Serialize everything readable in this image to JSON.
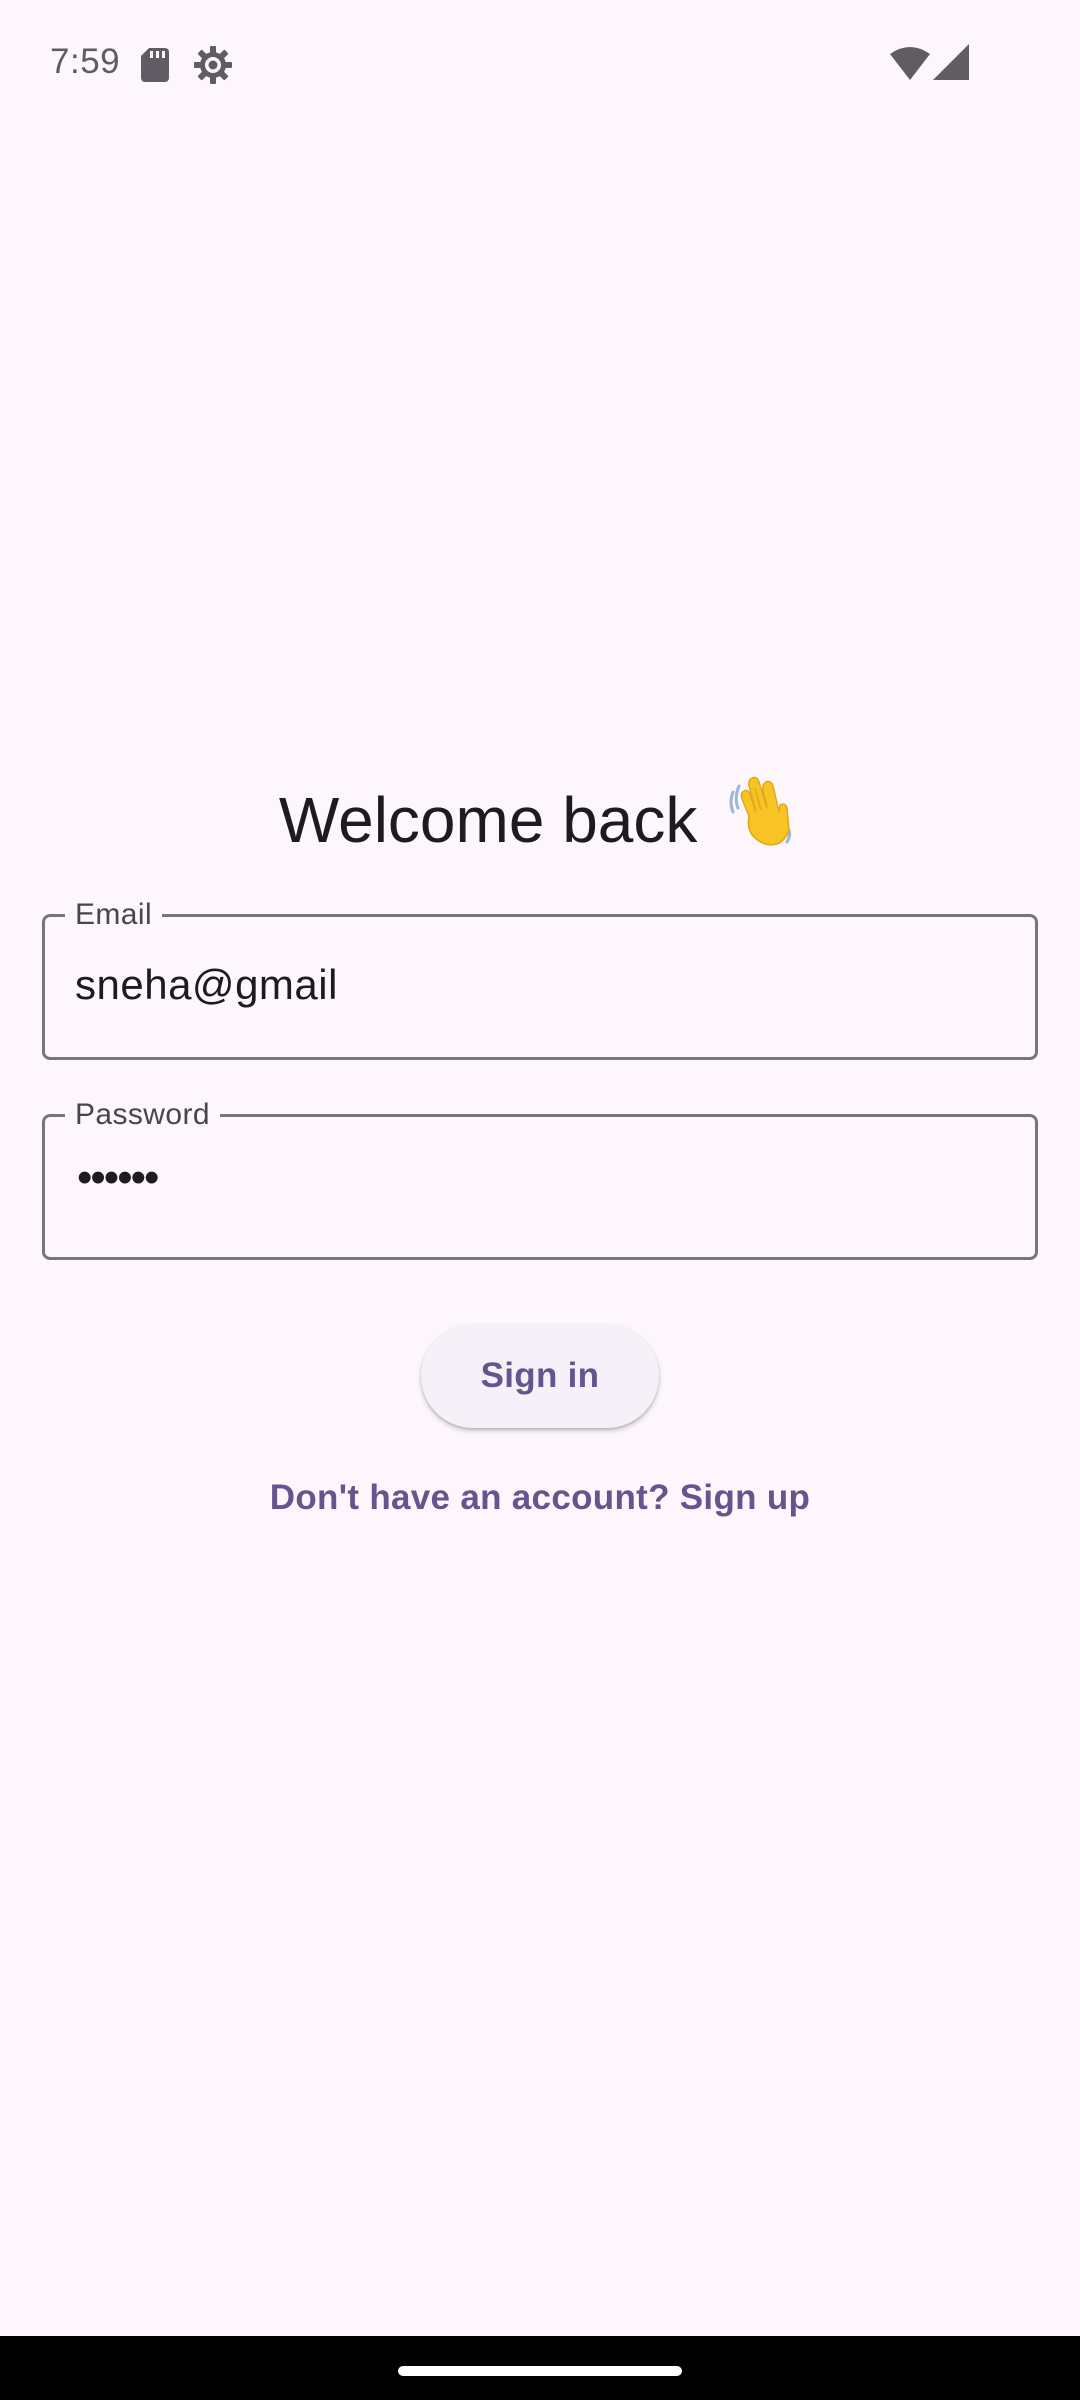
{
  "status_bar": {
    "time": "7:59",
    "icons": [
      "sd-card-icon",
      "gear-icon",
      "wifi-icon",
      "signal-icon"
    ]
  },
  "login": {
    "title": "Welcome back",
    "title_emoji_icon": "waving-hand-icon",
    "email": {
      "label": "Email",
      "value": "sneha@gmail"
    },
    "password": {
      "label": "Password",
      "masked_value": "••••••"
    },
    "signin_label": "Sign in",
    "signup_link": "Don't have an account? Sign up"
  },
  "colors": {
    "background": "#fdf6fc",
    "primary": "#65558f",
    "outline": "#79747e",
    "on_surface": "#1d1b20",
    "button_surface": "#f6f1f8",
    "emoji_yellow": "#f7c325"
  }
}
